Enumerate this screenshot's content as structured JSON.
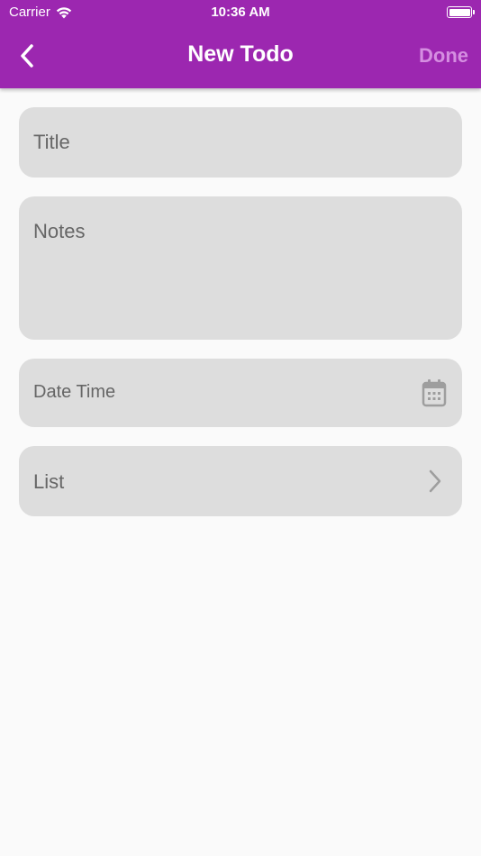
{
  "status_bar": {
    "carrier": "Carrier",
    "time": "10:36 AM",
    "wifi_icon": "wifi-icon",
    "battery_icon": "battery-icon"
  },
  "app_bar": {
    "title": "New Todo",
    "back_icon": "chevron-left-icon",
    "done_label": "Done",
    "background_color": "#9c27b0"
  },
  "form": {
    "title_placeholder": "Title",
    "notes_placeholder": "Notes",
    "datetime_placeholder": "Date Time",
    "datetime_icon": "calendar-icon",
    "list_placeholder": "List",
    "list_icon": "chevron-right-icon"
  }
}
